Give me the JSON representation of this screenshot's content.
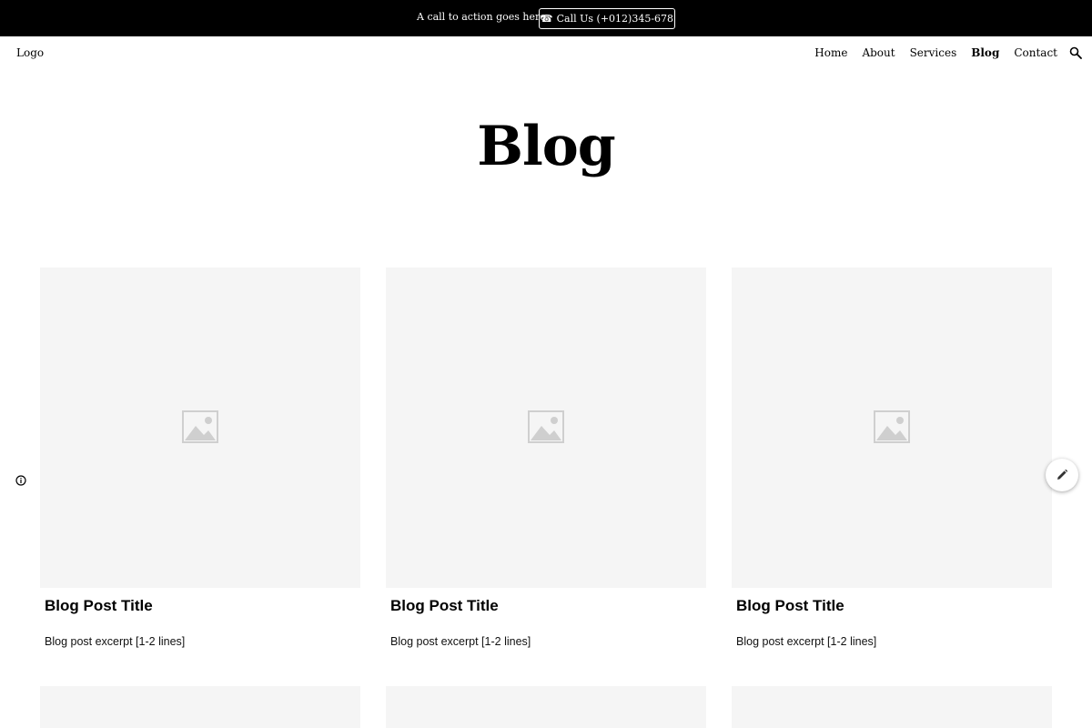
{
  "announcement": {
    "text": "A call to action goes here",
    "cta_label": "Call Us (+012)345-678",
    "cta_icon": "phone-icon"
  },
  "header": {
    "logo": "Logo",
    "nav": [
      {
        "label": "Home",
        "active": false
      },
      {
        "label": "About",
        "active": false
      },
      {
        "label": "Services",
        "active": false
      },
      {
        "label": "Blog",
        "active": true
      },
      {
        "label": "Contact",
        "active": false
      }
    ],
    "search_icon": "search-icon"
  },
  "page": {
    "title": "Blog"
  },
  "posts": [
    {
      "title": "Blog Post Title",
      "excerpt": "Blog post excerpt [1-2 lines]",
      "image_icon": "image-placeholder-icon"
    },
    {
      "title": "Blog Post Title",
      "excerpt": "Blog post excerpt [1-2 lines]",
      "image_icon": "image-placeholder-icon"
    },
    {
      "title": "Blog Post Title",
      "excerpt": "Blog post excerpt [1-2 lines]",
      "image_icon": "image-placeholder-icon"
    }
  ],
  "floating": {
    "info_icon": "info-icon",
    "edit_icon": "pencil-icon"
  },
  "colors": {
    "bar_background": "#000000",
    "card_placeholder": "#f5f5f5",
    "placeholder_icon": "#cfcfcf"
  }
}
